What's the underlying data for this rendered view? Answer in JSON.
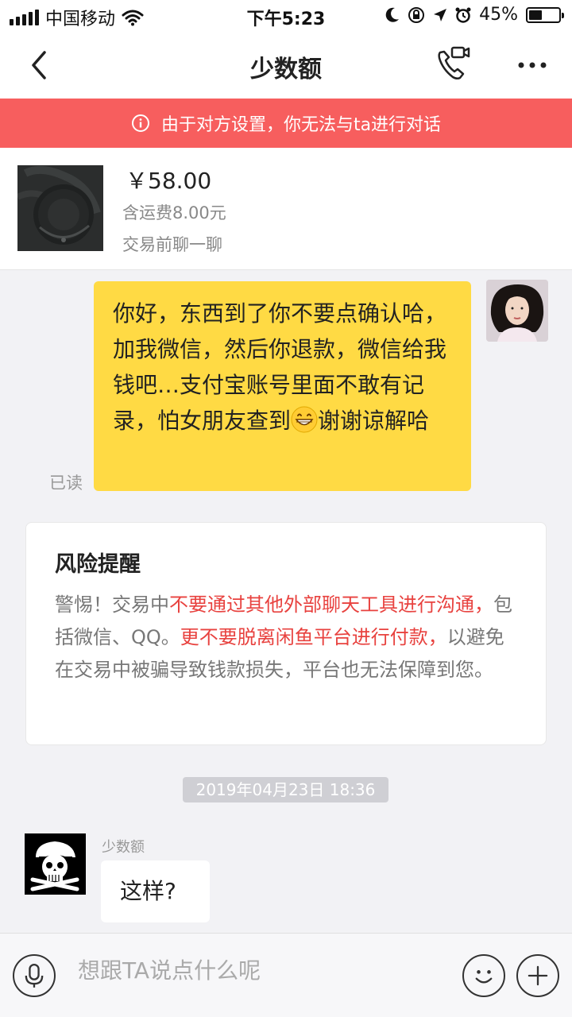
{
  "status_bar": {
    "carrier": "中国移动",
    "time": "下午5:23",
    "battery_percent": "45%",
    "battery_level": 0.45
  },
  "nav": {
    "title": "少数额",
    "back_icon": "chevron-left-icon",
    "call_icon": "phone-video-icon",
    "more_icon": "more-dots-icon"
  },
  "banner": {
    "text": "由于对方设置，你无法与ta进行对话",
    "icon": "info-icon",
    "color": "#f75e5e"
  },
  "product": {
    "price": "￥58.00",
    "shipping": "含运费8.00元",
    "tag": "交易前聊一聊"
  },
  "messages": {
    "outgoing": {
      "text_before_emoji": "你好，东西到了你不要点确认哈，加我微信，然后你退款，微信给我钱吧…支付宝账号里面不敢有记录，怕女朋友查到",
      "text_after_emoji": "谢谢谅解哈",
      "emoji": "grin-emoji",
      "read_status": "已读",
      "bubble_color": "#ffda44"
    },
    "risk": {
      "title": "风险提醒",
      "part1": "警惕！交易中",
      "part2_red": "不要通过其他外部聊天工具进行沟通，",
      "part3": "包括微信、QQ。",
      "part4_red": "更不要脱离闲鱼平台进行付款，",
      "part5": "以避免在交易中被骗导致钱款损失，平台也无法保障到您。",
      "red_color": "#e8423f"
    },
    "timestamp": "2019年04月23日 18:36",
    "incoming": {
      "sender": "少数额",
      "text": "这样?"
    }
  },
  "input_bar": {
    "placeholder": "想跟TA说点什么呢",
    "mic_icon": "microphone-icon",
    "emoji_icon": "smiley-icon",
    "plus_icon": "plus-icon"
  }
}
